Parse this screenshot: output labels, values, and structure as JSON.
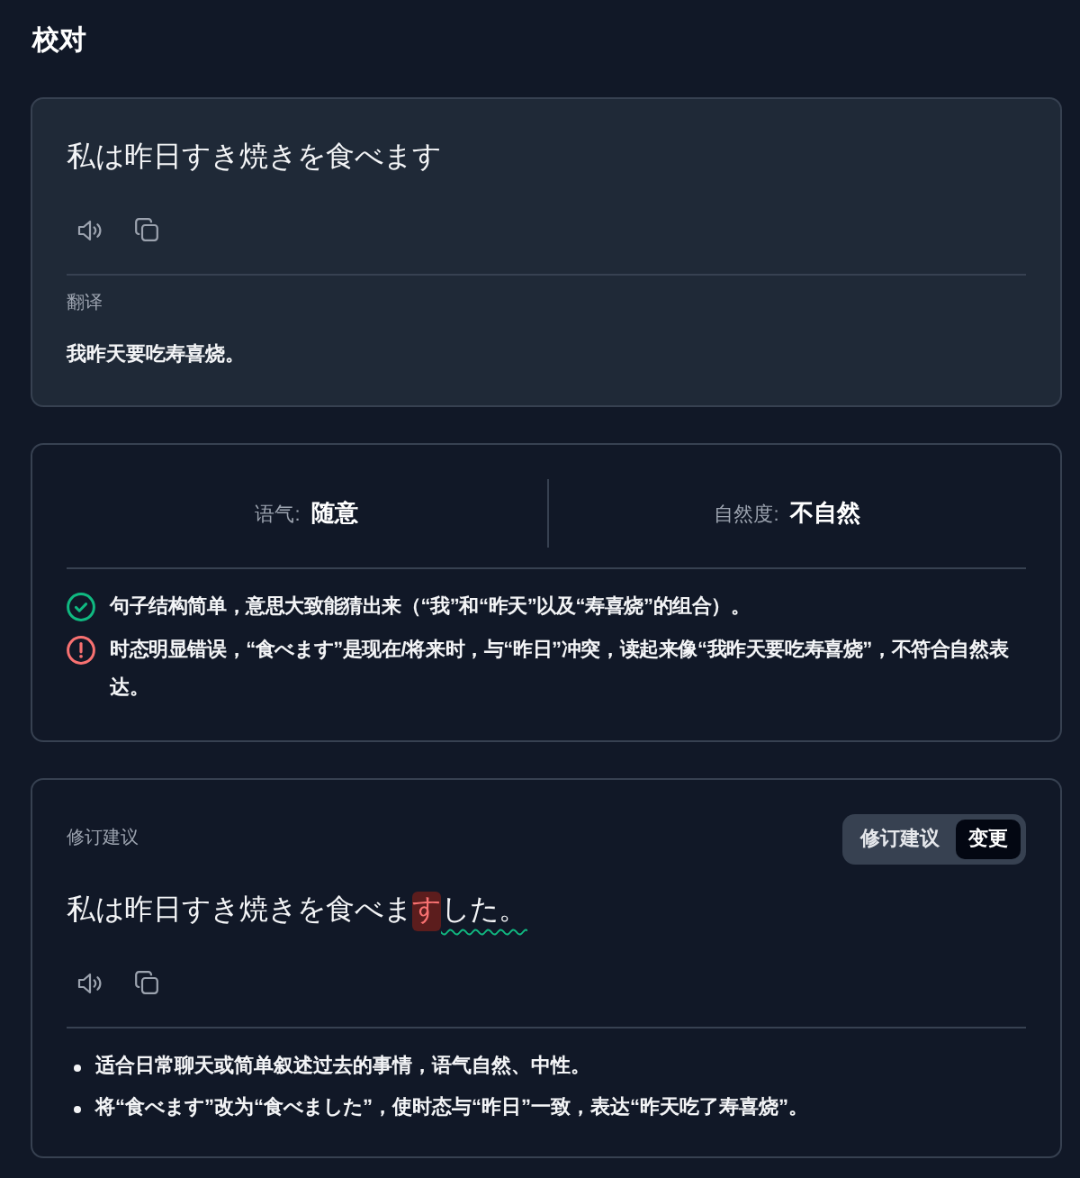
{
  "title": "校对",
  "source": {
    "sentence": "私は昨日すき焼きを食べます",
    "translation_label": "翻译",
    "translation": "我昨天要吃寿喜烧。"
  },
  "assessment": {
    "metrics": [
      {
        "label": "语气:",
        "value": "随意"
      },
      {
        "label": "自然度:",
        "value": "不自然"
      }
    ],
    "feedback": [
      {
        "kind": "positive",
        "text": "句子结构简单，意思大致能猜出来（“我”和“昨天”以及“寿喜烧”的组合）。"
      },
      {
        "kind": "negative",
        "text": "时态明显错误，“食べます”是现在/将来时，与“昨日”冲突，读起来像“我昨天要吃寿喜烧”，不符合自然表达。"
      }
    ]
  },
  "revision": {
    "label": "修订建议",
    "view_toggle": [
      {
        "label": "修订建议",
        "selected": false
      },
      {
        "label": "变更",
        "selected": true
      }
    ],
    "segments": [
      {
        "kind": "unchanged",
        "text": "私は昨日すき焼きを食べま"
      },
      {
        "kind": "deleted",
        "text": "す"
      },
      {
        "kind": "inserted",
        "text": "した。"
      }
    ],
    "notes": [
      "适合日常聊天或简单叙述过去的事情，语气自然、中性。",
      "将“食べます”改为“食べました”，使时态与“昨日”一致，表达“昨天吃了寿喜烧”。"
    ]
  }
}
